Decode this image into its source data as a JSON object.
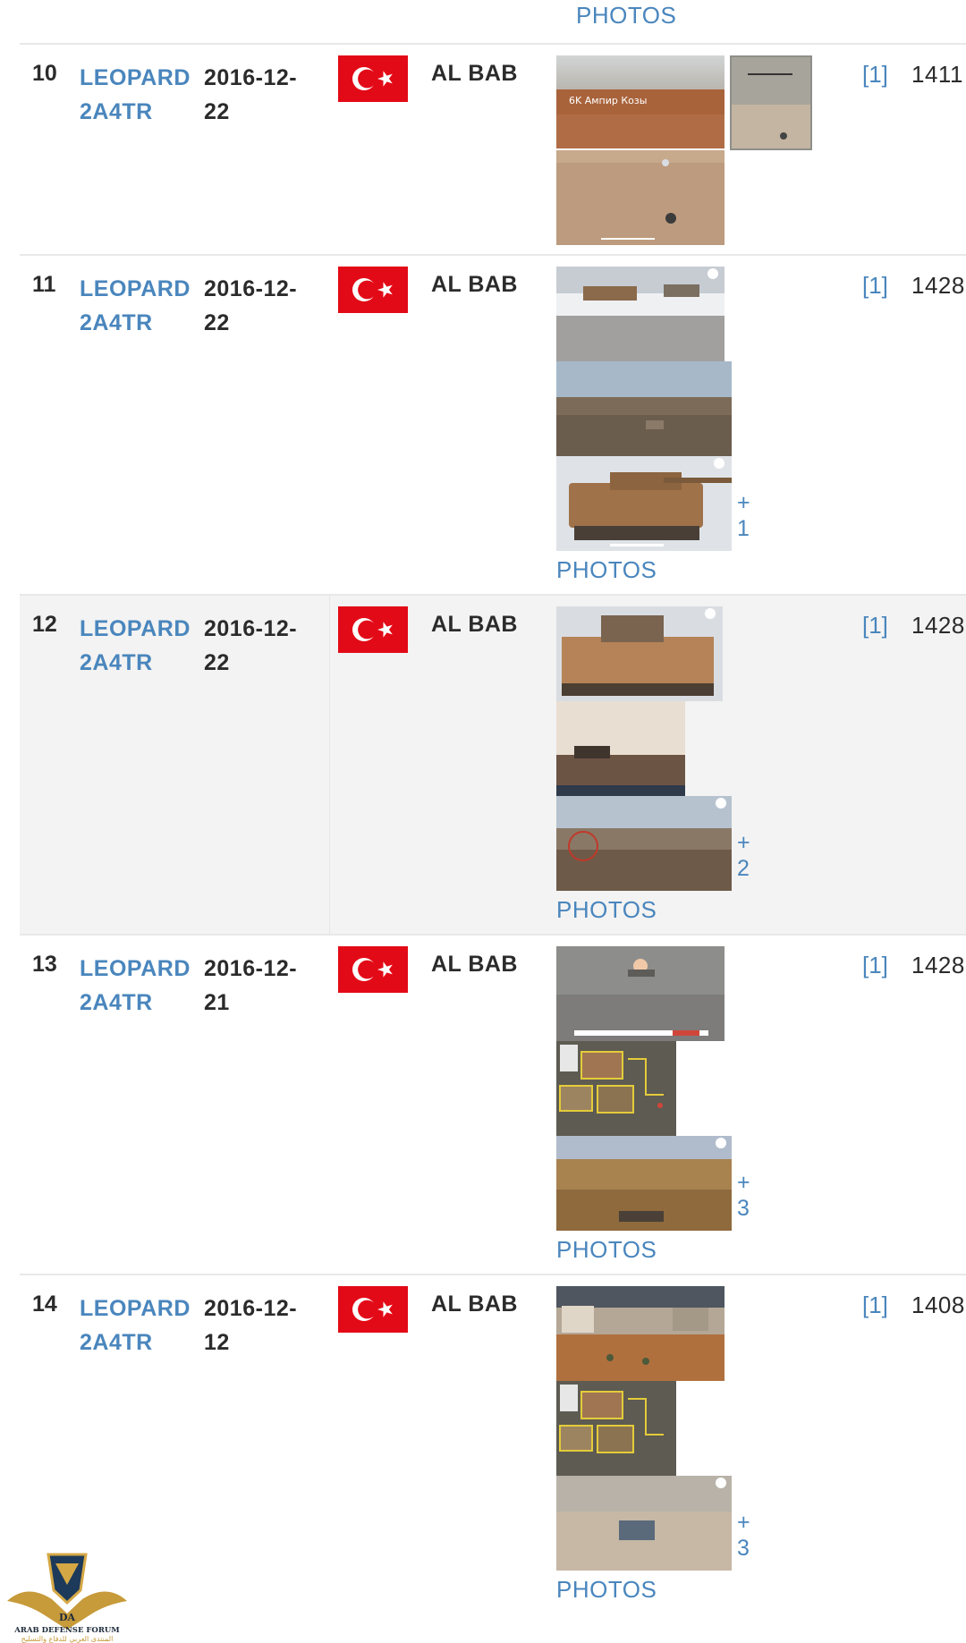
{
  "top_photos_label": "PHOTOS",
  "rows": [
    {
      "num": "10",
      "model": "LEOPARD 2A4TR",
      "date": "2016-12-22",
      "location": "AL BAB",
      "ref": "[1]",
      "id": "1411",
      "more": "",
      "photos_label": ""
    },
    {
      "num": "11",
      "model": "LEOPARD 2A4TR",
      "date": "2016-12-22",
      "location": "AL BAB",
      "ref": "[1]",
      "id": "1428",
      "more": "+ 1",
      "photos_label": "PHOTOS"
    },
    {
      "num": "12",
      "model": "LEOPARD 2A4TR",
      "date": "2016-12-22",
      "location": "AL BAB",
      "ref": "[1]",
      "id": "1428",
      "more": "+ 2",
      "photos_label": "PHOTOS"
    },
    {
      "num": "13",
      "model": "LEOPARD 2A4TR",
      "date": "2016-12-21",
      "location": "AL BAB",
      "ref": "[1]",
      "id": "1428",
      "more": "+ 3",
      "photos_label": "PHOTOS"
    },
    {
      "num": "14",
      "model": "LEOPARD 2A4TR",
      "date": "2016-12-12",
      "location": "AL BAB",
      "ref": "[1]",
      "id": "1408",
      "more": "+ 3",
      "photos_label": "PHOTOS"
    }
  ],
  "thumb_caption": "6K Ампир Козы",
  "watermark": {
    "monogram": "DA",
    "name_en": "ARAB DEFENSE FORUM",
    "name_ar": "المنتدى العربي للدفاع والتسليح"
  },
  "colors": {
    "link": "#4a86bd",
    "text": "#2b2b2b",
    "shade": "#f3f3f3",
    "flag_red": "#e30a17"
  }
}
